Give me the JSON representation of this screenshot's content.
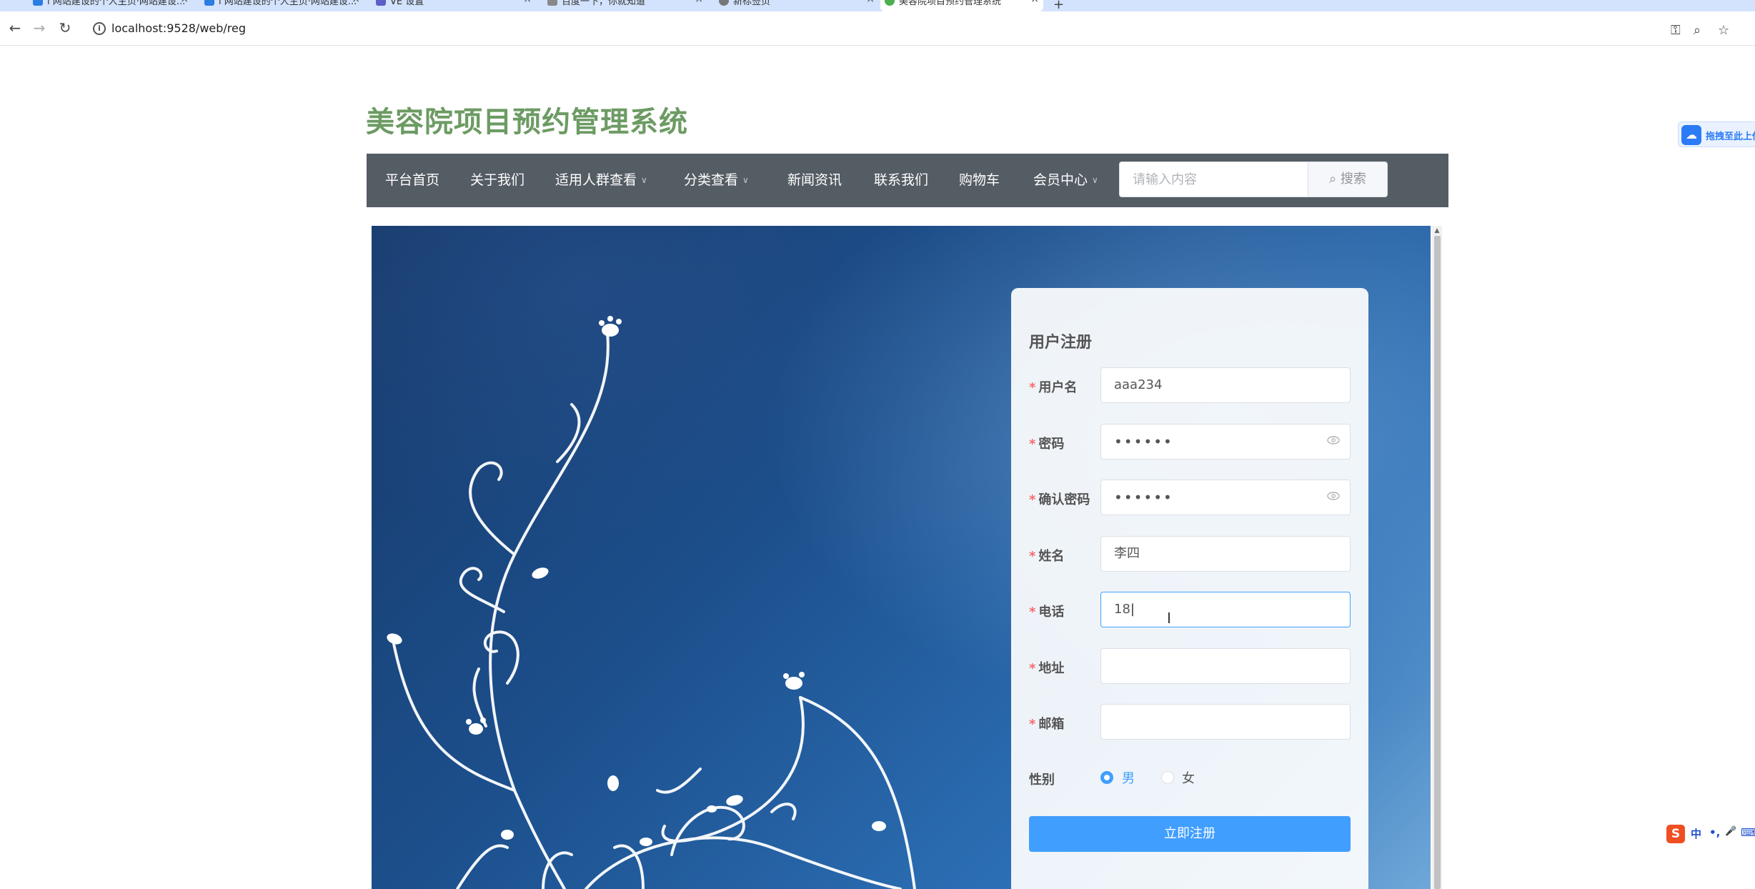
{
  "browser": {
    "tabs": [
      {
        "label": "ⅰ 网站建设的个人主页·网站建设...",
        "active": false
      },
      {
        "label": "ⅰ 网站建设的个人主页·网站建设...",
        "active": false
      },
      {
        "label": "VE 设置",
        "active": false
      },
      {
        "label": "百度一下，你就知道",
        "active": false
      },
      {
        "label": "新标签页",
        "active": false
      },
      {
        "label": "美容院项目预约管理系统",
        "active": true
      }
    ],
    "url": "localhost:9528/web/reg"
  },
  "site": {
    "title": "美容院项目预约管理系统"
  },
  "nav": {
    "items": [
      {
        "label": "平台首页",
        "dropdown": false
      },
      {
        "label": "关于我们",
        "dropdown": false
      },
      {
        "label": "适用人群查看",
        "dropdown": true
      },
      {
        "label": "分类查看",
        "dropdown": true
      },
      {
        "label": "新闻资讯",
        "dropdown": false
      },
      {
        "label": "联系我们",
        "dropdown": false
      },
      {
        "label": "购物车",
        "dropdown": false
      },
      {
        "label": "会员中心",
        "dropdown": true
      }
    ],
    "search_placeholder": "请输入内容",
    "search_button": "搜索"
  },
  "form": {
    "title": "用户注册",
    "fields": [
      {
        "label": "用户名",
        "required": true,
        "value": "aaa234",
        "type": "text"
      },
      {
        "label": "密码",
        "required": true,
        "value": "••••••",
        "type": "password"
      },
      {
        "label": "确认密码",
        "required": true,
        "value": "••••••",
        "type": "password"
      },
      {
        "label": "姓名",
        "required": true,
        "value": "李四",
        "type": "text"
      },
      {
        "label": "电话",
        "required": true,
        "value": "18",
        "type": "text",
        "focused": true
      },
      {
        "label": "地址",
        "required": true,
        "value": "",
        "type": "text"
      },
      {
        "label": "邮箱",
        "required": true,
        "value": "",
        "type": "text"
      }
    ],
    "gender": {
      "label": "性别",
      "options": [
        {
          "label": "男",
          "checked": true
        },
        {
          "label": "女",
          "checked": false
        }
      ]
    },
    "submit_label": "立即注册"
  },
  "widgets": {
    "upload_text": "拖拽至此上传",
    "ime": {
      "logo": "S",
      "items": [
        "中",
        "•,",
        "🎤",
        "⌨"
      ]
    }
  },
  "colors": {
    "title_green": "#6c9b63",
    "nav_bg": "#545c64",
    "primary": "#409eff",
    "required": "#f56c6c"
  }
}
